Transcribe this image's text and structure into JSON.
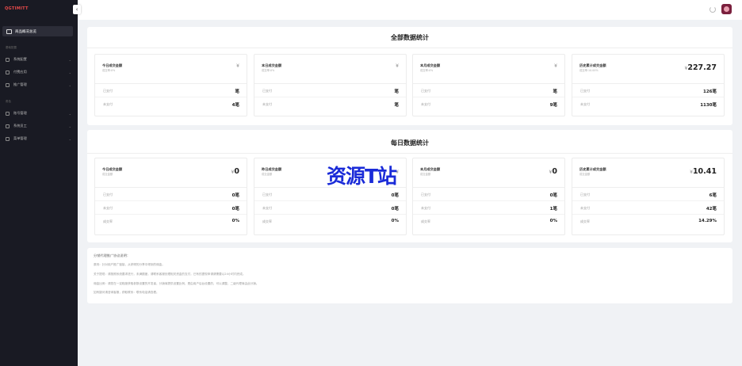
{
  "app": {
    "logo": "QGTIMITT"
  },
  "sidebar": {
    "active_item": "商品概况总览",
    "group1_label": "基础配置",
    "group1_items": [
      "系统配置",
      "付费应用",
      "推广管理"
    ],
    "group2_label": "角色",
    "group2_items": [
      "账号管理",
      "系统员工",
      "菜单管理"
    ]
  },
  "panel_total": {
    "title": "全部数据统计",
    "cards": [
      {
        "name": "今日成交金额",
        "sub": "成交率:0%",
        "yen": "¥",
        "amount": "",
        "rows": [
          {
            "label": "已支付",
            "value": "笔"
          },
          {
            "label": "未支付",
            "value": "4笔"
          }
        ]
      },
      {
        "name": "本日成交金额",
        "sub": "成交率:0%",
        "yen": "¥",
        "amount": "",
        "rows": [
          {
            "label": "已支付",
            "value": "笔"
          },
          {
            "label": "未支付",
            "value": "笔"
          }
        ]
      },
      {
        "name": "本月成交金额",
        "sub": "成交率:0%",
        "yen": "¥",
        "amount": "",
        "rows": [
          {
            "label": "已支付",
            "value": "笔"
          },
          {
            "label": "未支付",
            "value": "9笔"
          }
        ]
      },
      {
        "name": "历史累计成交金额",
        "sub": "成交率:10.00%",
        "yen": "¥",
        "amount": "227.27",
        "rows": [
          {
            "label": "已支付",
            "value": "126笔"
          },
          {
            "label": "未支付",
            "value": "1130笔"
          }
        ]
      }
    ]
  },
  "panel_daily": {
    "title": "每日数据统计",
    "cards": [
      {
        "name": "今日成交金额",
        "sub": "成交金额",
        "yen": "¥",
        "amount": "0",
        "rows": [
          {
            "label": "已支付",
            "value": "0笔"
          },
          {
            "label": "未支付",
            "value": "0笔"
          },
          {
            "label": "成交率",
            "value": "0%"
          }
        ]
      },
      {
        "name": "昨日成交金额",
        "sub": "成交金额",
        "yen": "¥",
        "amount": "",
        "rows": [
          {
            "label": "已支付",
            "value": "0笔"
          },
          {
            "label": "未支付",
            "value": "0笔"
          },
          {
            "label": "成交率",
            "value": "0%"
          }
        ]
      },
      {
        "name": "本月成交金额",
        "sub": "成交金额",
        "yen": "¥",
        "amount": "0",
        "rows": [
          {
            "label": "已支付",
            "value": "0笔"
          },
          {
            "label": "未支付",
            "value": "1笔"
          },
          {
            "label": "成交率",
            "value": "0%"
          }
        ]
      },
      {
        "name": "历史累计成交金额",
        "sub": "成交金额",
        "yen": "¥",
        "amount": "10.41",
        "rows": [
          {
            "label": "已支付",
            "value": "6笔"
          },
          {
            "label": "未支付",
            "value": "42笔"
          },
          {
            "label": "成交率",
            "value": "14.29%"
          }
        ]
      }
    ]
  },
  "watermark": "资源T站",
  "notes": {
    "title": "分销代理推广协议说明：",
    "lines": [
      "原则：针对用户推广链接，从获得的分享中得到的佣金。",
      "关于提现：请按照系统要求进行，未满额度，请联系客服处理相关资金的支付，已有的提现申请请需要以24小时内完成。",
      "佣金比例：请您在一定程度获取参数设置的开发者，分销商提供设置比例，是由用户后台设置的，可以调整，二级代理商由此分销。",
      "如有疑问请咨询客服，获取联系：联系电话请查看。"
    ]
  }
}
